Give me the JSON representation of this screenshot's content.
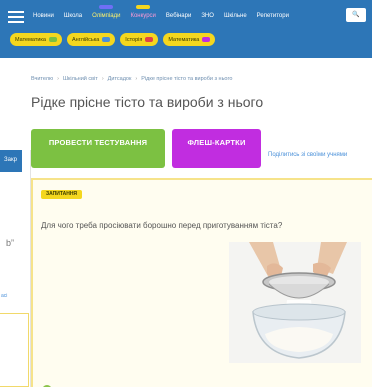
{
  "header": {
    "nav": [
      {
        "label": "Новини"
      },
      {
        "label": "Школа"
      },
      {
        "label": "Олімпіади",
        "tone": "yellow",
        "badge": "#6f6ff5"
      },
      {
        "label": "Конкурси",
        "tone": "pink",
        "badge": "#f4d71f"
      },
      {
        "label": "Вебінари"
      },
      {
        "label": "ЗНО"
      },
      {
        "label": "Шкільне"
      },
      {
        "label": "Репетитори"
      }
    ],
    "search_label": "🔍"
  },
  "pills": [
    {
      "label": "Математика",
      "dot_color": "#7cc142"
    },
    {
      "label": "Англійська",
      "dot_color": "#4a90d9"
    },
    {
      "label": "Історія",
      "dot_color": "#e04545"
    },
    {
      "label": "Математика",
      "dot_color": "#c12de0"
    }
  ],
  "breadcrumb": [
    "Вчителю",
    "Шкільний світ",
    "Дитсадок",
    "Рідке прісне тісто та вироби з нього"
  ],
  "page_title": "Рідке прісне тісто та вироби з нього",
  "buttons": {
    "test": {
      "label": "ПРОВЕСТИ ТЕСТУВАННЯ",
      "sub": "",
      "color": "#7cc142"
    },
    "flash": {
      "label": "ФЛЕШ-КАРТКИ",
      "sub": "",
      "color": "#c12de0"
    }
  },
  "share_link": "Поділитись зі своїми учнями",
  "side_popup": {
    "close_label": "Закр",
    "quote_text": "b”",
    "link_text": "aci"
  },
  "card": {
    "tag": "ЗАПИТАННЯ",
    "question": "Для чого треба просіювати борошно перед приготуванням тіста?",
    "image_icon": "flour-sifting-photo"
  },
  "colors": {
    "header": "#2d76b7",
    "accent_yellow": "#f4d71f",
    "card_border": "#f6e38a"
  }
}
